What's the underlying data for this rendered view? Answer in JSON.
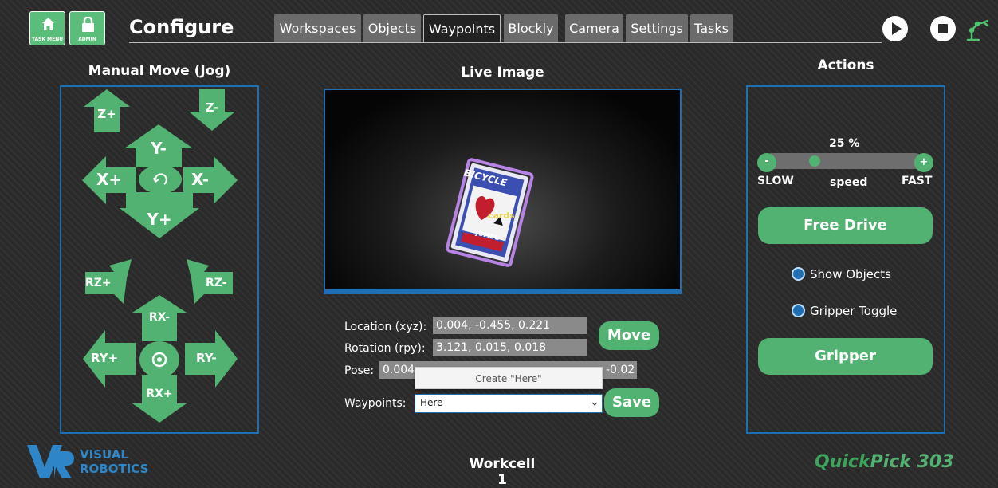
{
  "header": {
    "task_menu_label": "TASK MENU",
    "admin_label": "ADMIN",
    "title": "Configure",
    "tabs": [
      {
        "label": "Workspaces",
        "active": false
      },
      {
        "label": "Objects",
        "active": false
      },
      {
        "label": "Waypoints",
        "active": true
      },
      {
        "label": "Blockly",
        "active": false
      },
      {
        "label": "Camera",
        "active": false
      },
      {
        "label": "Settings",
        "active": false
      },
      {
        "label": "Tasks",
        "active": false
      }
    ],
    "icons": [
      "home-icon",
      "lock-icon",
      "play-icon",
      "stop-icon",
      "robot-arm-icon"
    ]
  },
  "jog": {
    "heading": "Manual Move (Jog)",
    "labels": {
      "z_plus": "Z+",
      "z_minus": "Z-",
      "y_minus": "Y-",
      "y_plus": "Y+",
      "x_plus": "X+",
      "x_minus": "X-",
      "rz_plus": "RZ+",
      "rz_minus": "RZ-",
      "rx_minus": "RX-",
      "rx_plus": "RX+",
      "ry_plus": "RY+",
      "ry_minus": "RY-"
    }
  },
  "live": {
    "heading": "Live Image",
    "detected_label": "cards",
    "card_brand": "BICYCLE",
    "card_size": "JUMBO"
  },
  "pose": {
    "location_label": "Location (xyz):",
    "location_value": "0.004, -0.455, 0.221",
    "rotation_label": "Rotation (rpy):",
    "rotation_value": "3.121, 0.015, 0.018",
    "pose_label": "Pose:",
    "pose_value_left": "0.004",
    "pose_value_right": "-0.02",
    "move_label": "Move",
    "tooltip": "Create \"Here\"",
    "waypoints_label": "Waypoints:",
    "waypoints_selected": "Here",
    "save_label": "Save"
  },
  "actions": {
    "heading": "Actions",
    "speed_percent_label": "25 %",
    "speed_value": 0.25,
    "slow_label": "SLOW",
    "speed_label": "speed",
    "fast_label": "FAST",
    "minus_label": "-",
    "plus_label": "+",
    "free_drive_label": "Free Drive",
    "show_objects_label": "Show Objects",
    "gripper_toggle_label": "Gripper Toggle",
    "gripper_label": "Gripper"
  },
  "footer": {
    "logo_line1": "VISUAL",
    "logo_line2": "ROBOTICS",
    "workcell": "Workcell 1",
    "product_quick": "Quick",
    "product_pick": "Pick 303"
  },
  "colors": {
    "accent_green": "#52b271",
    "panel_blue": "#1f6fb5",
    "tab_gray": "#6b6b6b"
  }
}
